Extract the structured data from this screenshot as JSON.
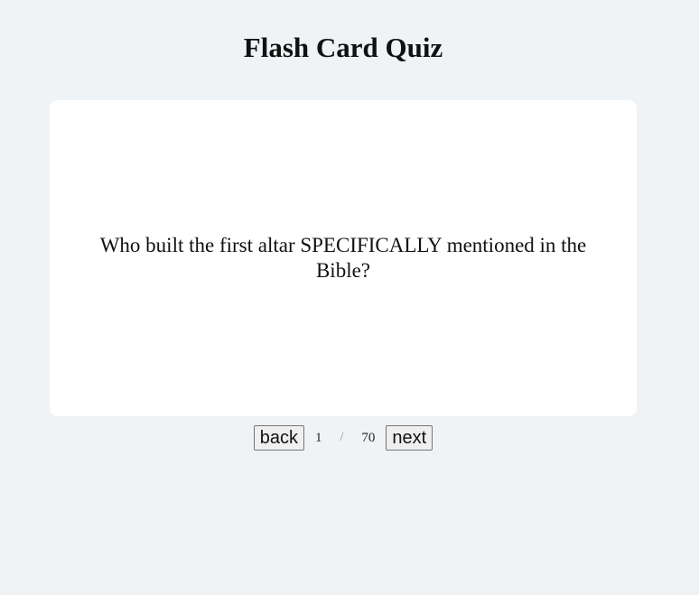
{
  "header": {
    "title": "Flash Card Quiz"
  },
  "card": {
    "question": "Who built the first altar SPECIFICALLY mentioned in the Bible?"
  },
  "navigation": {
    "back_label": "back",
    "next_label": "next",
    "current": "1",
    "separator": "/",
    "total": "70"
  },
  "colors": {
    "background": "#f0f3f6",
    "card": "#ffffff"
  }
}
